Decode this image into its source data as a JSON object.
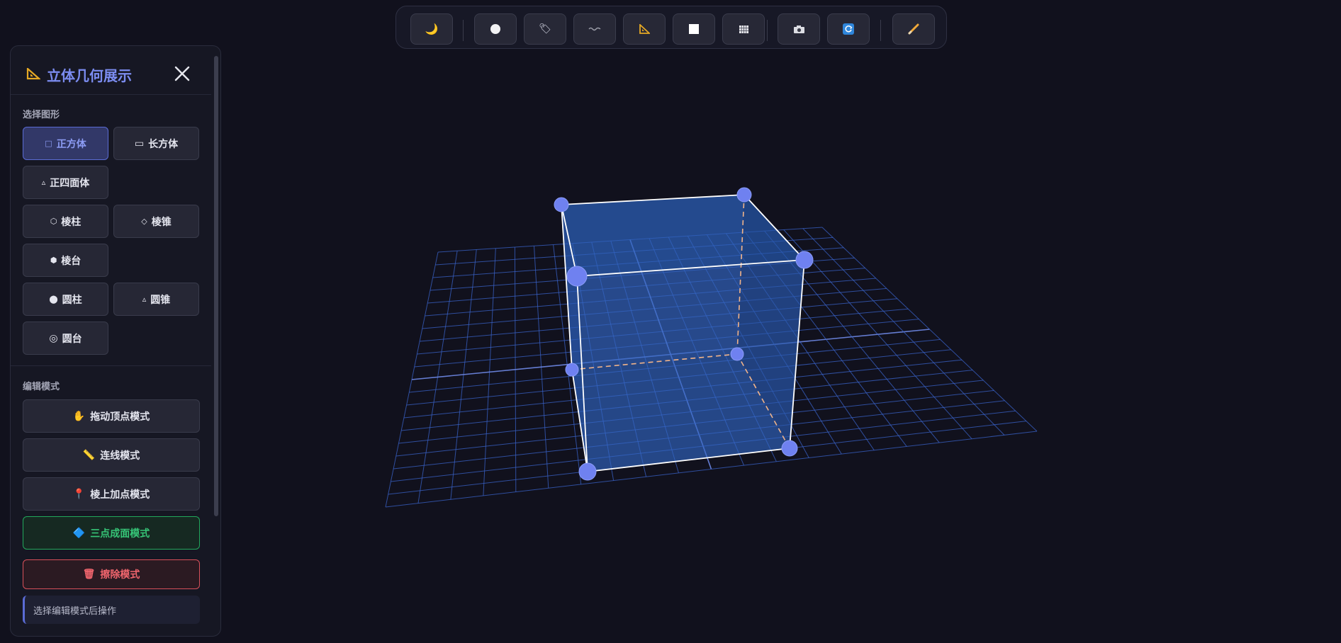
{
  "toolbar": {
    "buttons": [
      {
        "icon": "moon-icon",
        "glyph": "🌙"
      },
      {
        "icon": "circle-icon",
        "glyph": "⬤"
      },
      {
        "icon": "tag-icon",
        "glyph": "🏷"
      },
      {
        "icon": "wave-icon",
        "glyph": "〰"
      },
      {
        "icon": "triangle-ruler-icon",
        "glyph": "📐"
      },
      {
        "icon": "square-icon",
        "glyph": "⬜"
      },
      {
        "icon": "grid-icon",
        "glyph": "▦"
      },
      {
        "icon": "camera-icon",
        "glyph": "📷"
      },
      {
        "icon": "refresh-icon",
        "glyph": "🔄"
      },
      {
        "icon": "pencil-icon",
        "glyph": "✏"
      }
    ]
  },
  "panel": {
    "title": "立体几何展示",
    "title_icon": "📐",
    "shape_section_label": "选择图形",
    "shapes": [
      {
        "glyph": "□",
        "label": "正方体",
        "active": true
      },
      {
        "glyph": "▭",
        "label": "长方体",
        "active": false
      },
      {
        "glyph": "▵",
        "label": "正四面体",
        "active": false
      },
      {
        "glyph": "⬡",
        "label": "棱柱",
        "active": false
      },
      {
        "glyph": "◇",
        "label": "棱锥",
        "active": false
      },
      {
        "glyph": "⬢",
        "label": "棱台",
        "active": false
      },
      {
        "glyph": "⬤",
        "label": "圆柱",
        "active": false
      },
      {
        "glyph": "▵",
        "label": "圆锥",
        "active": false
      },
      {
        "glyph": "◎",
        "label": "圆台",
        "active": false
      }
    ],
    "mode_section_label": "编辑模式",
    "modes": [
      {
        "glyph": "✋",
        "label": "拖动顶点模式"
      },
      {
        "glyph": "📏",
        "label": "连线模式"
      },
      {
        "glyph": "📍",
        "label": "棱上加点模式"
      },
      {
        "glyph": "🔷",
        "label": "三点成面模式"
      },
      {
        "glyph": "🗑",
        "label": "擦除模式"
      }
    ],
    "hint": "选择编辑模式后操作"
  },
  "colors": {
    "background": "#11111d",
    "accent": "#6c7df0",
    "grid": "#3a63c9",
    "face": "#2b5db4",
    "green": "#22a85c",
    "red": "#d8505a"
  }
}
